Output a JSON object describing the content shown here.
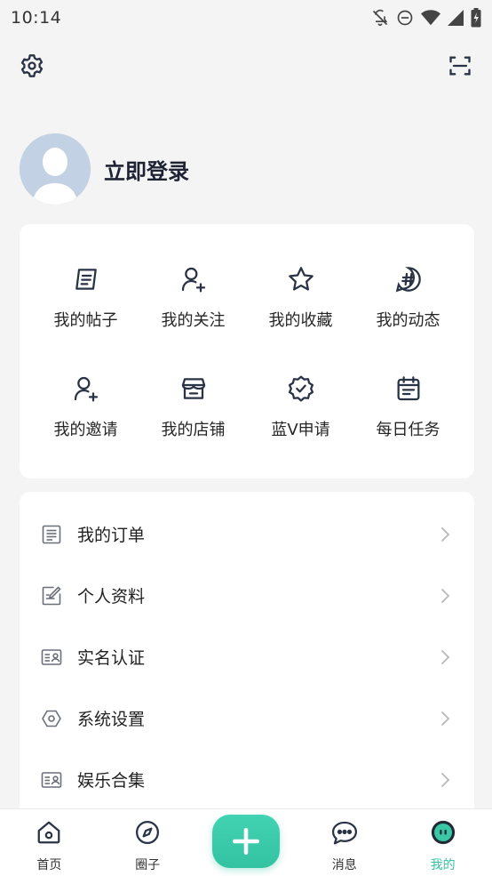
{
  "status": {
    "time": "10:14"
  },
  "profile": {
    "login_label": "立即登录"
  },
  "grid": {
    "row1": [
      {
        "label": "我的帖子",
        "icon": "post-icon"
      },
      {
        "label": "我的关注",
        "icon": "user-follow-icon"
      },
      {
        "label": "我的收藏",
        "icon": "star-icon"
      },
      {
        "label": "我的动态",
        "icon": "hashtag-icon"
      }
    ],
    "row2": [
      {
        "label": "我的邀请",
        "icon": "user-invite-icon"
      },
      {
        "label": "我的店铺",
        "icon": "store-icon"
      },
      {
        "label": "蓝V申请",
        "icon": "verified-badge-icon"
      },
      {
        "label": "每日任务",
        "icon": "calendar-icon"
      }
    ]
  },
  "list": [
    {
      "label": "我的订单",
      "icon": "order-icon"
    },
    {
      "label": "个人资料",
      "icon": "edit-profile-icon"
    },
    {
      "label": "实名认证",
      "icon": "id-card-icon"
    },
    {
      "label": "系统设置",
      "icon": "hexagon-settings-icon"
    },
    {
      "label": "娱乐合集",
      "icon": "collection-card-icon"
    }
  ],
  "tabs": [
    {
      "label": "首页",
      "icon": "home-icon"
    },
    {
      "label": "圈子",
      "icon": "compass-icon"
    },
    {
      "label": "消息",
      "icon": "message-icon"
    },
    {
      "label": "我的",
      "icon": "mine-face-icon"
    }
  ],
  "colors": {
    "accent": "#35c4a3",
    "icon": "#2a3345"
  }
}
